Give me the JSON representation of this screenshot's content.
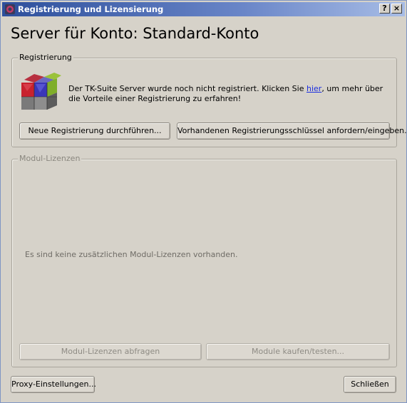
{
  "window": {
    "title": "Registrierung und Lizensierung",
    "help_label": "?",
    "close_label": "×"
  },
  "page_title": "Server für Konto: Standard-Konto",
  "registration": {
    "legend": "Registrierung",
    "text_before_link": "Der TK-Suite Server wurde noch nicht registriert. Klicken Sie ",
    "link_text": "hier",
    "text_after_link": ", um mehr über die Vorteile einer Registrierung zu erfahren!",
    "new_button": "Neue Registrierung durchführen...",
    "key_button": "Vorhandenen Registrierungsschlüssel anfordern/eingeben..."
  },
  "modules": {
    "legend": "Modul-Lizenzen",
    "empty_message": "Es sind keine zusätzlichen Modul-Lizenzen vorhanden.",
    "query_button": "Modul-Lizenzen abfragen",
    "buy_button": "Module kaufen/testen..."
  },
  "footer": {
    "proxy_button": "Proxy-Einstellungen...",
    "close_button": "Schließen"
  },
  "colors": {
    "dialog_bg": "#d6d2c9",
    "titlebar_start": "#2d4f9c",
    "link": "#1b2ee0",
    "disabled_text": "#8e8b84"
  }
}
